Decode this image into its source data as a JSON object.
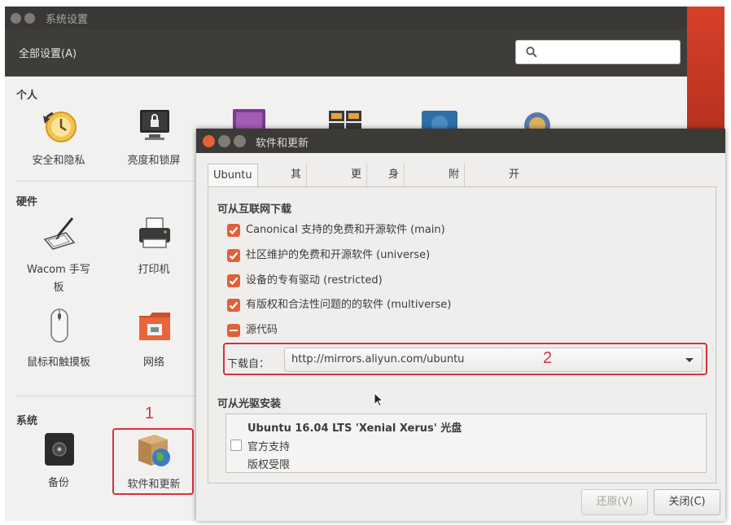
{
  "settings_window": {
    "title": "系统设置",
    "all_settings": "全部设置(A)",
    "sections": {
      "personal": "个人",
      "hardware": "硬件",
      "system": "系统"
    },
    "personal_items": [
      "安全和隐私",
      "亮度和锁屏"
    ],
    "hardware_items": [
      "Wacom 手写",
      "板",
      "打印机",
      "鼠标和触摸板",
      "网络"
    ],
    "system_items": [
      "备份",
      "软件和更新"
    ]
  },
  "annotations": {
    "step1": "1",
    "step2": "2"
  },
  "dialog": {
    "title": "软件和更新",
    "tabs": [
      "Ubuntu 软件",
      "其它软件",
      "更新",
      "身份验证",
      "附加驱动",
      "开发者选项"
    ],
    "active_tab": "Ubuntu 软件",
    "internet_group": "可从互联网下载",
    "repos": [
      {
        "label": "Canonical 支持的免费和开源软件 (main)",
        "state": "checked"
      },
      {
        "label": "社区维护的免费和开源软件 (universe)",
        "state": "checked"
      },
      {
        "label": "设备的专有驱动 (restricted)",
        "state": "checked"
      },
      {
        "label": "有版权和合法性问题的的软件 (multiverse)",
        "state": "checked"
      },
      {
        "label": "源代码",
        "state": "mixed"
      }
    ],
    "download_from_label": "下载自：",
    "download_from_value": "http://mirrors.aliyun.com/ubuntu",
    "cdrom_group": "可从光驱安装",
    "cdrom": {
      "name": "Ubuntu 16.04 LTS 'Xenial Xerus' 光盘",
      "line2": "官方支持",
      "line3": "版权受限"
    },
    "revert_button": "还原(V)",
    "close_button": "关闭(C)"
  },
  "colors": {
    "accent": "#e0603a",
    "highlight": "#d9303b",
    "titlebar": "#3c3a37"
  }
}
